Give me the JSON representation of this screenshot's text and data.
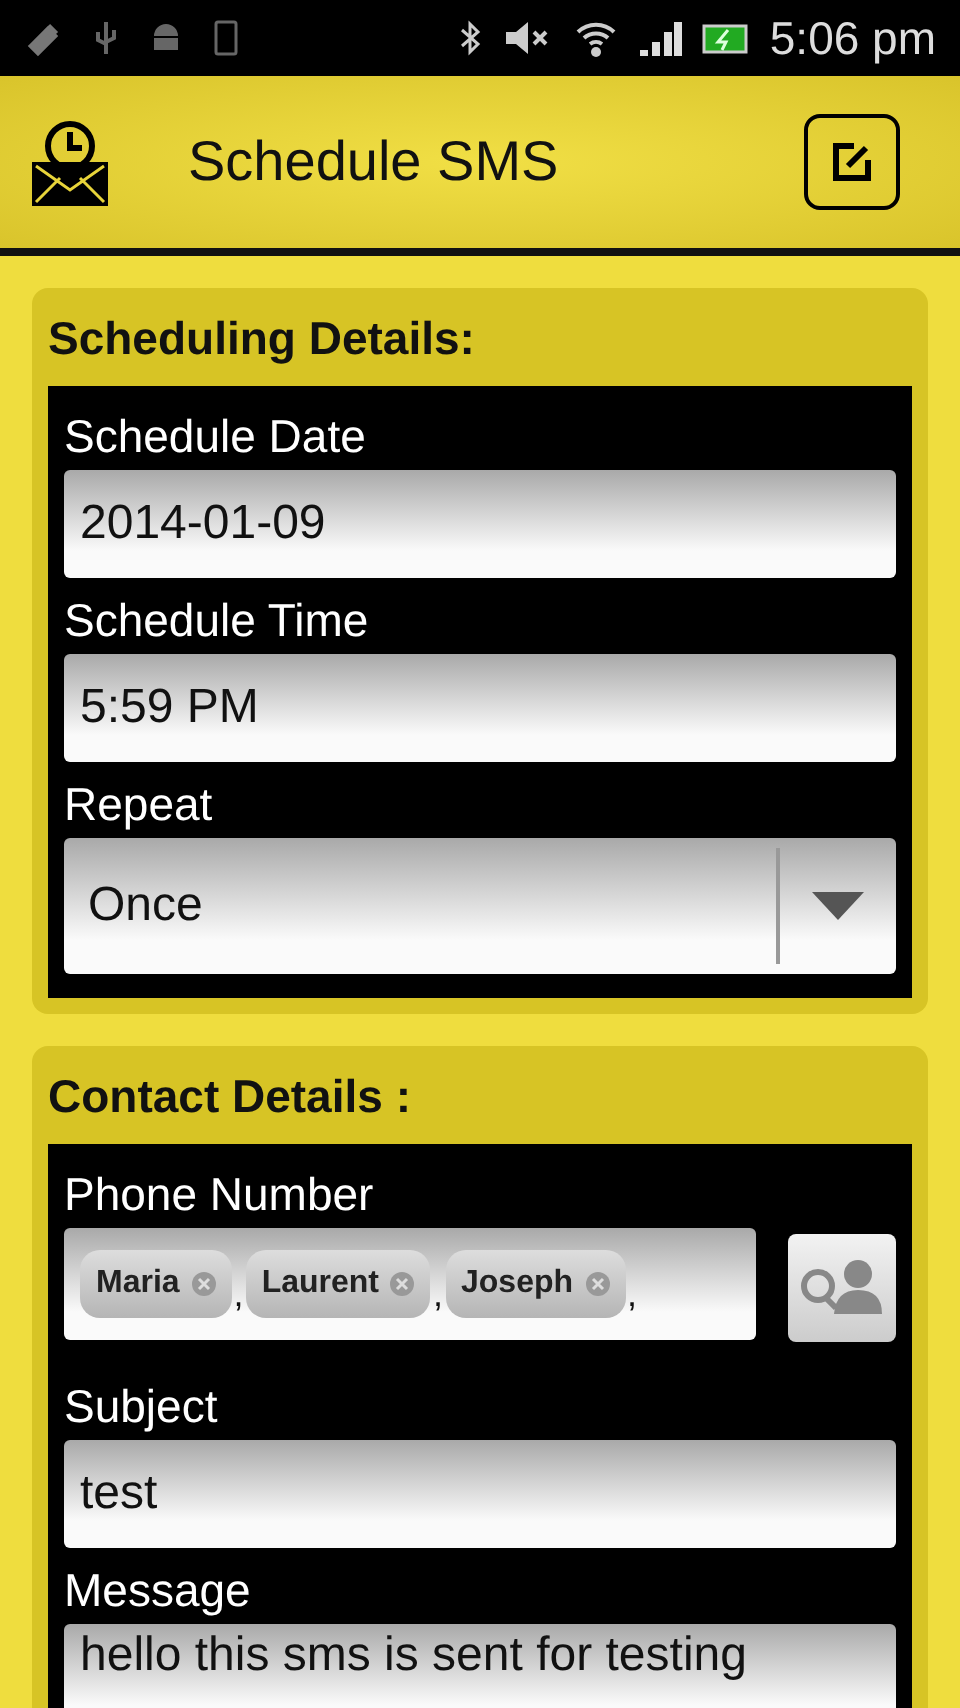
{
  "status_bar": {
    "time": "5:06 pm"
  },
  "app_bar": {
    "title": "Schedule SMS"
  },
  "sections": [
    {
      "title": "Scheduling Details:",
      "fields": [
        {
          "kind": "text",
          "label": "Schedule Date",
          "value": "2014-01-09"
        },
        {
          "kind": "text",
          "label": "Schedule Time",
          "value": "5:59 PM"
        },
        {
          "kind": "dropdown",
          "label": "Repeat",
          "value": "Once"
        }
      ]
    },
    {
      "title": "Contact Details :",
      "fields": [
        {
          "kind": "chips",
          "label": "Phone Number",
          "chips": [
            {
              "label": "Maria",
              "separator": ","
            },
            {
              "label": "Laurent",
              "separator": ","
            },
            {
              "label": "Joseph",
              "separator": ","
            }
          ]
        },
        {
          "kind": "text",
          "label": "Subject",
          "value": "test"
        },
        {
          "kind": "text",
          "label": "Message",
          "value": "hello this sms is sent for testing"
        }
      ]
    }
  ]
}
